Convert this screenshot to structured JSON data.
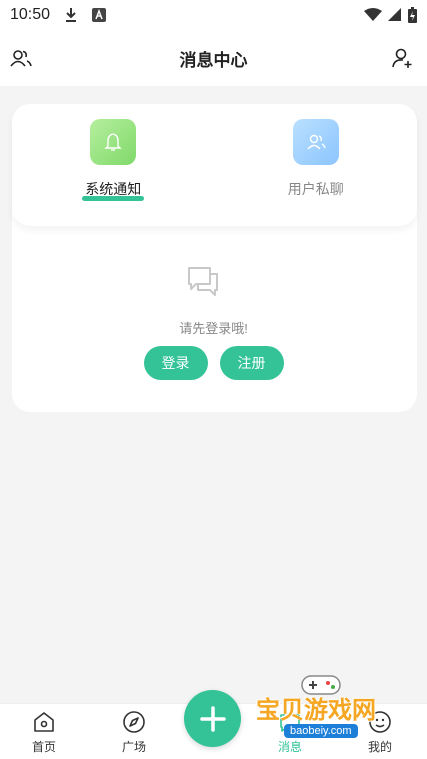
{
  "status_bar": {
    "time": "10:50"
  },
  "header": {
    "title": "消息中心"
  },
  "tabs": [
    {
      "label": "系统通知",
      "icon": "bell-icon",
      "active": true
    },
    {
      "label": "用户私聊",
      "icon": "users-icon",
      "active": false
    }
  ],
  "empty_state": {
    "message": "请先登录哦!",
    "login_label": "登录",
    "register_label": "注册"
  },
  "bottom_nav": {
    "home_label": "首页",
    "plaza_label": "广场",
    "message_label": "消息",
    "mine_label": "我的"
  },
  "watermark": {
    "text": "宝贝游戏网",
    "url": "baobeiy.com"
  },
  "colors": {
    "accent": "#33c397",
    "background": "#f4f4f4"
  }
}
